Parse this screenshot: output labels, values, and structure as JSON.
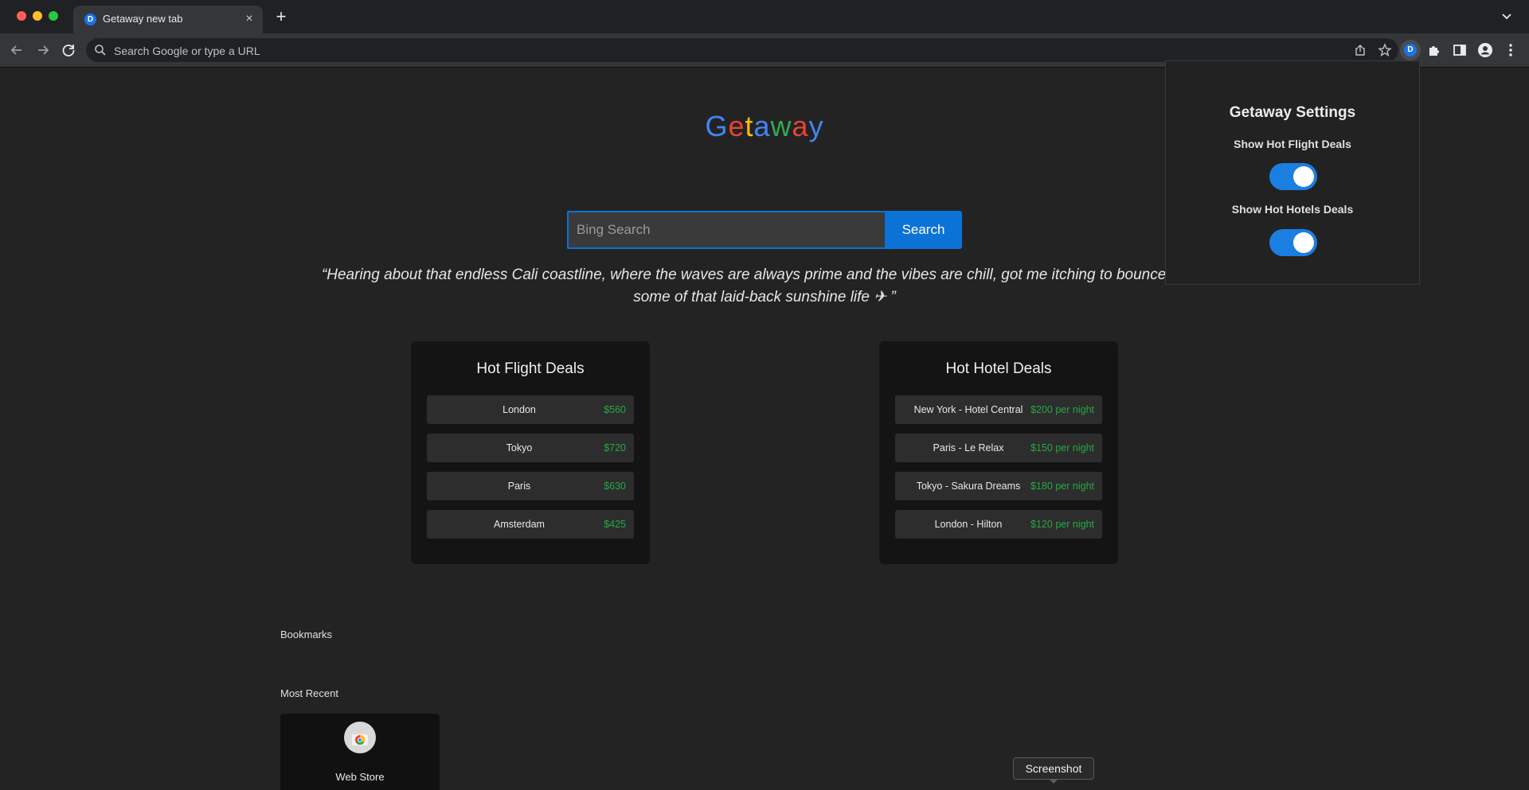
{
  "browser": {
    "tab_title": "Getaway new tab",
    "tab_favicon": "D",
    "omnibox_placeholder": "Search Google or type a URL",
    "extension_badge": "D"
  },
  "page": {
    "logo_letters": [
      "G",
      "e",
      "t",
      "a",
      "w",
      "a",
      "y"
    ],
    "search": {
      "placeholder": "Bing Search",
      "button_label": "Search"
    },
    "quote": "“Hearing about that endless Cali coastline, where the waves are always prime and the vibes are chill, got me itching to bounce and s",
    "quote_line2": "some of that laid-back sunshine life ✈ ”",
    "flights": {
      "title": "Hot Flight Deals",
      "items": [
        {
          "name": "London",
          "price": "$560"
        },
        {
          "name": "Tokyo",
          "price": "$720"
        },
        {
          "name": "Paris",
          "price": "$630"
        },
        {
          "name": "Amsterdam",
          "price": "$425"
        }
      ]
    },
    "hotels": {
      "title": "Hot Hotel Deals",
      "items": [
        {
          "name": "New York - Hotel Central",
          "price": "$200 per night"
        },
        {
          "name": "Paris - Le Relax",
          "price": "$150 per night"
        },
        {
          "name": "Tokyo - Sakura Dreams",
          "price": "$180 per night"
        },
        {
          "name": "London - Hilton",
          "price": "$120 per night"
        }
      ]
    },
    "bookmarks_label": "Bookmarks",
    "most_recent_label": "Most Recent",
    "recent_tiles": [
      {
        "title": "Web Store"
      }
    ],
    "tooltip": "Screenshot"
  },
  "popup": {
    "title": "Getaway Settings",
    "toggles": [
      {
        "label": "Show Hot Flight Deals",
        "on": true
      },
      {
        "label": "Show Hot Hotels Deals",
        "on": true
      }
    ]
  },
  "colors": {
    "accent": "#0b72d6",
    "price": "#27a844",
    "toggle_on": "#1a7fe0"
  }
}
